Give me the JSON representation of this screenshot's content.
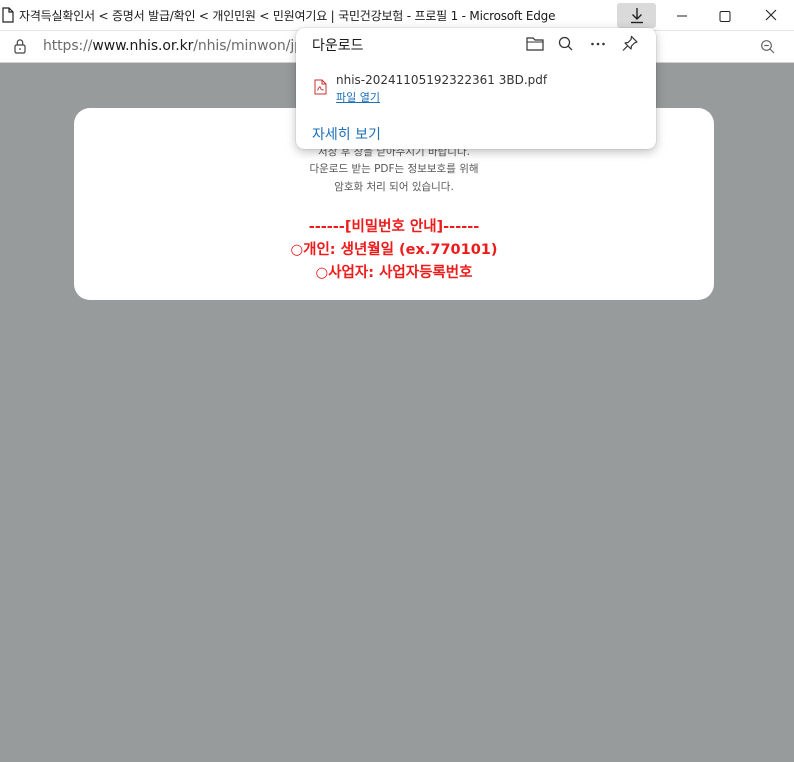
{
  "window": {
    "title": "자격득실확인서 < 증명서 발급/확인 < 개인민원 < 민원여기요 | 국민건강보험 - 프로필 1 - Microsoft Edge"
  },
  "address_bar": {
    "url_scheme": "https://",
    "url_host": "www.nhis.or.kr",
    "url_path": "/nhis/minwon/jpAe"
  },
  "downloads": {
    "title": "다운로드",
    "file_name": "nhis-20241105192322361 3BD.pdf",
    "open_file": "파일 열기",
    "see_more": "자세히 보기",
    "icons": [
      "folder-icon",
      "search-icon",
      "more-icon",
      "pin-icon"
    ]
  },
  "notice": {
    "partial_line": "저장 후 창을 닫아주시기 바랍니다.",
    "line1": "다운로드 받는 PDF는 정보보호를 위해",
    "line2": "암호화 처리 되어 있습니다.",
    "password_header": "------[비밀번호 안내]------",
    "personal": "○개인: 생년월일 (ex.770101)",
    "business": "○사업자: 사업자등록번호"
  },
  "colors": {
    "background": "#989b9b",
    "accent_red": "#ee1b1b",
    "link_blue": "#1f6fb6"
  }
}
